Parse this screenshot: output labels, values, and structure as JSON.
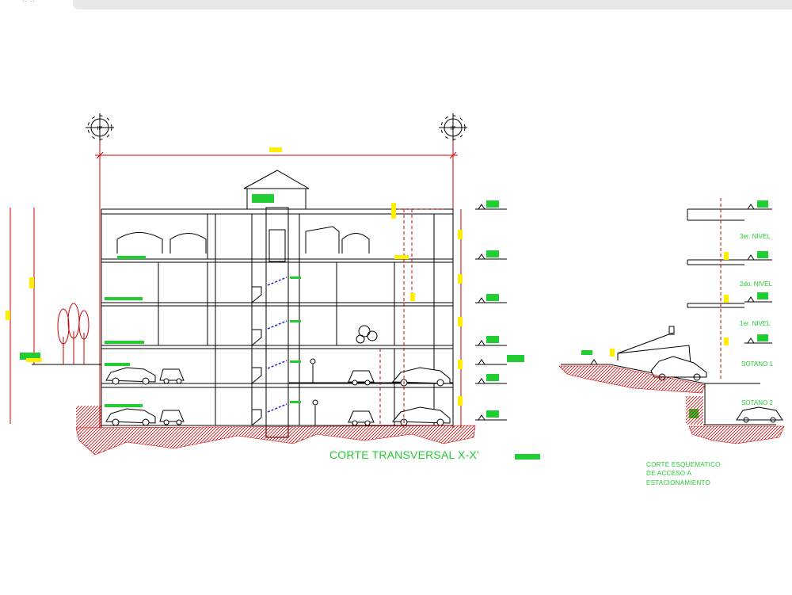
{
  "browser": {
    "tab_strip": "",
    "corner_glyphs": "··  ··"
  },
  "drawing": {
    "axis_markers": [
      "IP",
      "IP"
    ],
    "section_title": "CORTE TRANSVERSAL X-X'",
    "access_note": [
      "CORTE ESQUEMATICO",
      "DE ACCESO A",
      "ESTACIONAMIENTO"
    ],
    "right_levels": [
      "3er. NIVEL",
      "2do. NIVEL",
      "1er. NIVEL",
      "SOTANO 1",
      "SOTANO 2"
    ],
    "colors": {
      "line": "#000000",
      "dimension": "#cc0000",
      "label": "#22cc33",
      "highlight": "#ffee00",
      "ground": "#cc0000",
      "glass": "#2222cc"
    }
  }
}
